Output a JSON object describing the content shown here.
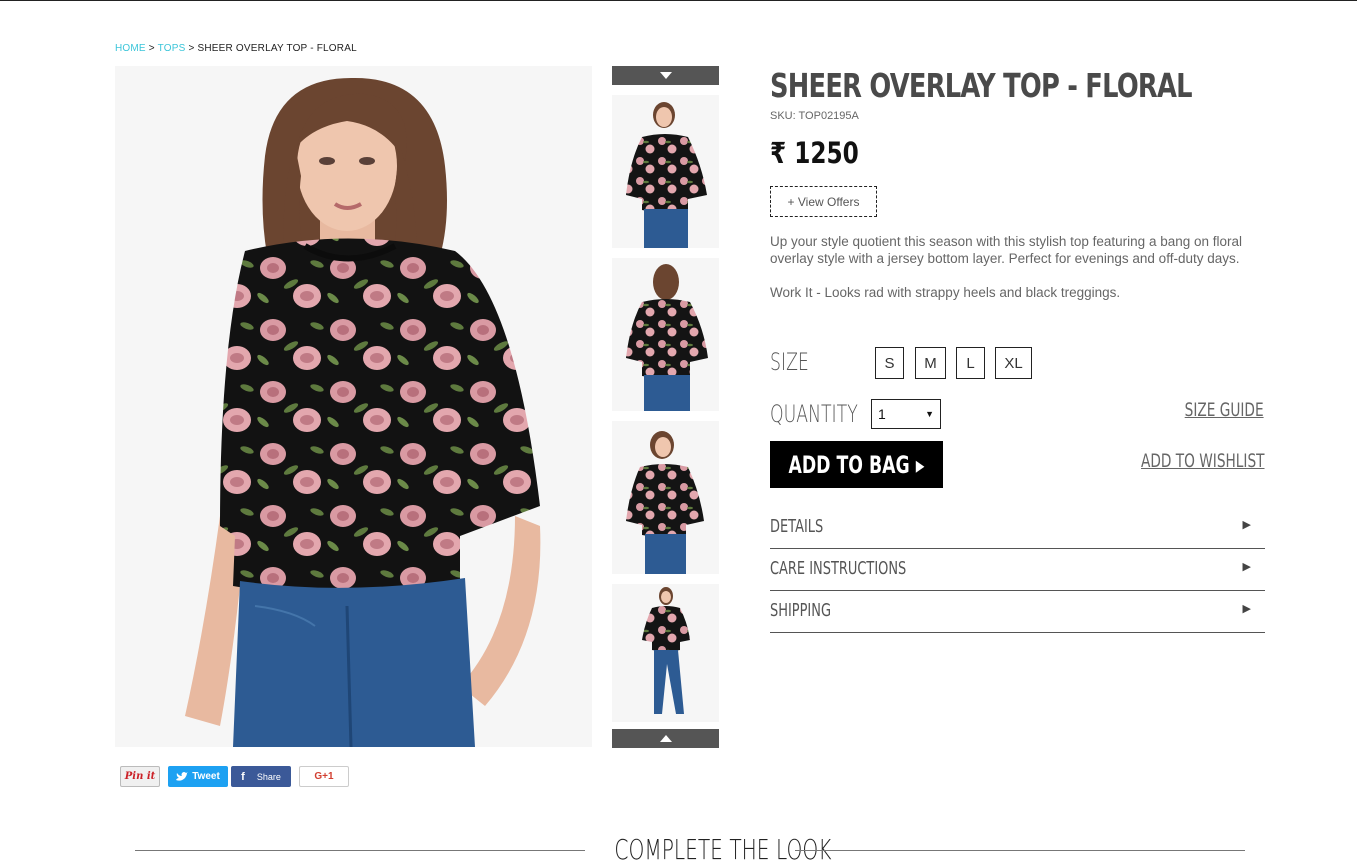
{
  "breadcrumb": {
    "home": "HOME",
    "sep1": " > ",
    "tops": "TOPS",
    "sep2": " > ",
    "current": "SHEER OVERLAY TOP - FLORAL"
  },
  "product": {
    "title": "SHEER OVERLAY TOP - FLORAL",
    "sku": "SKU: TOP02195A",
    "price": "₹ 1250",
    "offers_label": "+ View Offers",
    "description": [
      "Up your style quotient this season with this stylish top featuring a bang on floral overlay style with a jersey bottom layer. Perfect for evenings and off-duty days.",
      "Work It - Looks rad with strappy heels and black treggings."
    ]
  },
  "size": {
    "label": "SIZE",
    "options": [
      "S",
      "M",
      "L",
      "XL"
    ]
  },
  "quantity": {
    "label": "QUANTITY",
    "value": "1"
  },
  "links": {
    "size_guide": "SIZE GUIDE",
    "wishlist": "ADD TO WISHLIST"
  },
  "cta": {
    "add_to_bag": "ADD TO BAG ▸"
  },
  "accordion": [
    "DETAILS",
    "CARE INSTRUCTIONS",
    "SHIPPING"
  ],
  "social": {
    "pin": "Pin it",
    "tweet": "Tweet",
    "share": "Share",
    "gplus": "G+1"
  },
  "section": {
    "complete_look": "COMPLETE THE LOOK"
  },
  "colors": {
    "accent_link": "#3bc5d9",
    "button_bg": "#000000",
    "arrow_bar": "#555555"
  }
}
